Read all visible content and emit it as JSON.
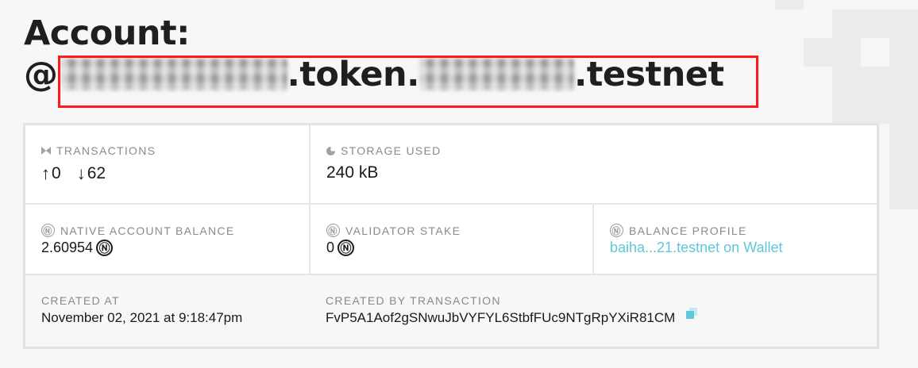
{
  "header": {
    "title_line1": "Account:",
    "account_prefix": "@",
    "account_mid": ".token.",
    "account_suffix": ".testnet"
  },
  "stats": {
    "transactions": {
      "label": "TRANSACTIONS",
      "sent_arrow": "↑",
      "sent": "0",
      "received_arrow": "↓",
      "received": "62"
    },
    "storage": {
      "label": "STORAGE USED",
      "value": "240 kB"
    },
    "balance": {
      "label": "NATIVE ACCOUNT BALANCE",
      "value": "2.60954"
    },
    "stake": {
      "label": "VALIDATOR STAKE",
      "value": "0"
    },
    "profile": {
      "label": "BALANCE PROFILE",
      "link_text": "baiha...21.testnet on Wallet"
    },
    "created_at": {
      "label": "CREATED AT",
      "value": "November 02, 2021 at 9:18:47pm"
    },
    "created_by": {
      "label": "CREATED BY TRANSACTION",
      "value": "FvP5A1Aof2gSNwuJbVYFYL6StbfFUc9NTgRpYXiR81CM"
    }
  },
  "icons": {
    "near": "Ⓝ",
    "transactions": "hourglass-icon",
    "storage": "pie-icon",
    "copy": "copy-icon"
  },
  "colors": {
    "link": "#5ec7d9",
    "highlight": "#ff1a1a"
  }
}
